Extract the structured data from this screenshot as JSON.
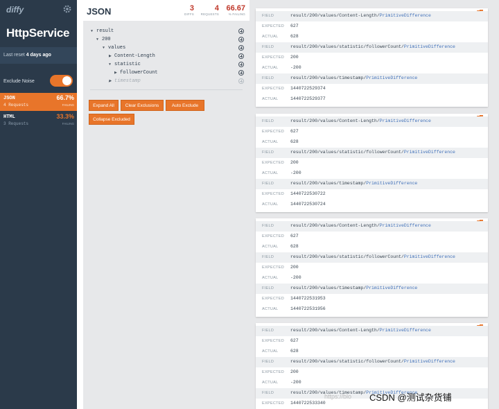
{
  "sidebar": {
    "logo": "diffy",
    "service_title": "HttpService",
    "last_reset_prefix": "Last reset",
    "last_reset_value": "4 days ago",
    "exclude_noise_label": "Exclude Noise",
    "exclude_noise_on": true,
    "endpoints": [
      {
        "name": "JSON",
        "requests": "4 Requests",
        "percent": "66.7%",
        "failing_label": "FAILING",
        "active": true
      },
      {
        "name": "HTML",
        "requests": "3 Requests",
        "percent": "33.3%",
        "failing_label": "FAILING",
        "active": false
      }
    ]
  },
  "middle": {
    "title": "JSON",
    "stats": [
      {
        "value": "3",
        "label": "DIFFS"
      },
      {
        "value": "4",
        "label": "REQUESTS"
      },
      {
        "value": "66.67",
        "label": "% FAILING"
      }
    ],
    "tree": [
      {
        "label": "result",
        "expanded": true,
        "excluded": false
      },
      {
        "label": "200",
        "expanded": true,
        "excluded": false
      },
      {
        "label": "values",
        "expanded": true,
        "excluded": false
      },
      {
        "label": "Content-Length",
        "expanded": false,
        "excluded": false
      },
      {
        "label": "statistic",
        "expanded": true,
        "excluded": false
      },
      {
        "label": "followerCount",
        "expanded": false,
        "excluded": false
      },
      {
        "label": "timestamp",
        "expanded": false,
        "excluded": true
      }
    ],
    "buttons": {
      "expand_all": "Expand All",
      "clear_exclusions": "Clear Exclusions",
      "auto_exclude": "Auto Exclude",
      "collapse_excluded": "Collapse Excluded"
    }
  },
  "right": {
    "field_key": "FIELD",
    "expected_key": "EXPECTED",
    "actual_key": "ACTUAL",
    "diff_type": "PrimitiveDifference",
    "cards": [
      {
        "diffs": [
          {
            "path": "result/200/values/Content-Length/",
            "expected": "627",
            "actual": "628"
          },
          {
            "path": "result/200/values/statistic/followerCount/",
            "expected": "200",
            "actual": "-200"
          },
          {
            "path": "result/200/values/timestamp/",
            "expected": "1440722529374",
            "actual": "1440722529377"
          }
        ]
      },
      {
        "diffs": [
          {
            "path": "result/200/values/Content-Length/",
            "expected": "627",
            "actual": "628"
          },
          {
            "path": "result/200/values/statistic/followerCount/",
            "expected": "200",
            "actual": "-200"
          },
          {
            "path": "result/200/values/timestamp/",
            "expected": "1440722530722",
            "actual": "1440722530724"
          }
        ]
      },
      {
        "diffs": [
          {
            "path": "result/200/values/Content-Length/",
            "expected": "627",
            "actual": "628"
          },
          {
            "path": "result/200/values/statistic/followerCount/",
            "expected": "200",
            "actual": "-200"
          },
          {
            "path": "result/200/values/timestamp/",
            "expected": "1440722531953",
            "actual": "1440722531956"
          }
        ]
      },
      {
        "diffs": [
          {
            "path": "result/200/values/Content-Length/",
            "expected": "627",
            "actual": "628"
          },
          {
            "path": "result/200/values/statistic/followerCount/",
            "expected": "200",
            "actual": "-200"
          },
          {
            "path": "result/200/values/timestamp/",
            "expected": "1440722533340",
            "actual": ""
          }
        ]
      }
    ]
  },
  "watermark": {
    "url": "https://blo",
    "text": "CSDN @测试杂货铺"
  },
  "colors": {
    "accent": "#e8752a",
    "sidebar_bg": "#2b3a4a",
    "failing_red": "#c0392b",
    "link_blue": "#3f6fb8"
  }
}
